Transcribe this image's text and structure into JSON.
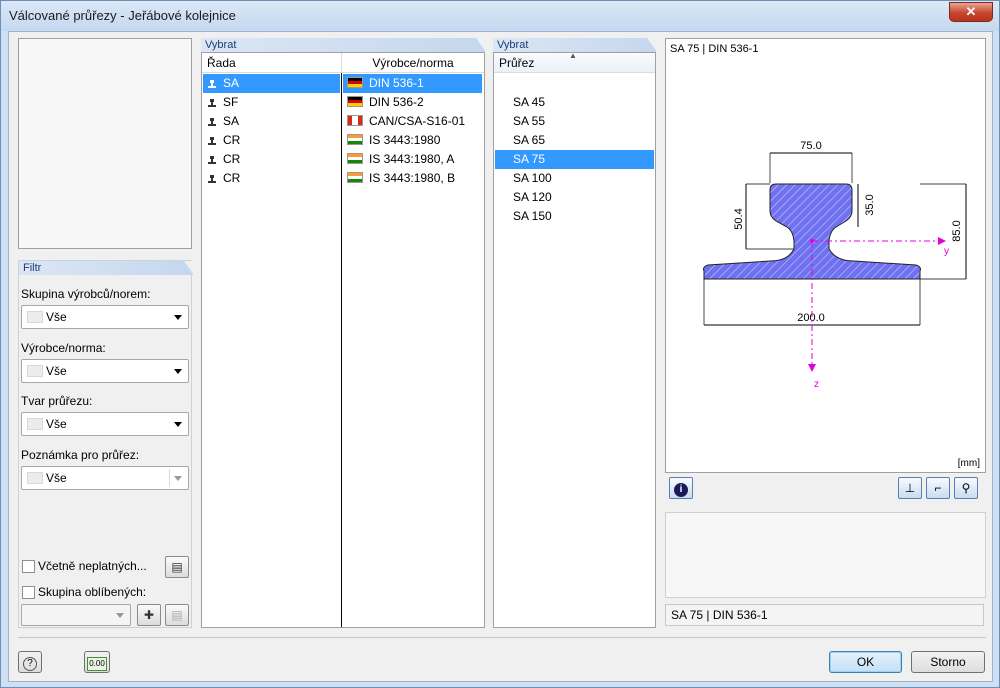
{
  "window": {
    "title": "Válcované průřezy - Jeřábové kolejnice",
    "close_label": "✕"
  },
  "filter": {
    "header": "Filtr",
    "group_label": "Skupina výrobců/norem:",
    "group_value": "Vše",
    "manufacturer_label": "Výrobce/norma:",
    "manufacturer_value": "Vše",
    "shape_label": "Tvar průřezu:",
    "shape_value": "Vše",
    "note_label": "Poznámka pro průřez:",
    "note_value": "Vše",
    "include_invalid_label": "Včetně neplatných...",
    "favorites_label": "Skupina oblíbených:"
  },
  "select_series": {
    "header": "Vybrat",
    "col_series": "Řada",
    "col_manufacturer": "Výrobce/norma",
    "rows": [
      {
        "series": "SA",
        "manufacturer": "DIN 536-1",
        "flag": "de",
        "selected": true
      },
      {
        "series": "SF",
        "manufacturer": "DIN 536-2",
        "flag": "de",
        "selected": false
      },
      {
        "series": "SA",
        "manufacturer": "CAN/CSA-S16-01",
        "flag": "ca",
        "selected": false
      },
      {
        "series": "CR",
        "manufacturer": "IS 3443:1980",
        "flag": "in",
        "selected": false
      },
      {
        "series": "CR",
        "manufacturer": "IS 3443:1980, A",
        "flag": "in",
        "selected": false
      },
      {
        "series": "CR",
        "manufacturer": "IS 3443:1980, B",
        "flag": "in",
        "selected": false
      }
    ]
  },
  "select_section": {
    "header": "Vybrat",
    "col_section": "Průřez",
    "rows": [
      "SA 45",
      "SA 55",
      "SA 65",
      "SA 75",
      "SA 100",
      "SA 120",
      "SA 150"
    ],
    "selected_index": 3
  },
  "preview": {
    "title": "SA 75 | DIN 536-1",
    "dim_top": "75.0",
    "dim_left": "50.4",
    "dim_head": "35.0",
    "dim_height": "85.0",
    "dim_base": "200.0",
    "axis_y": "y",
    "axis_z": "z",
    "units": "[mm]",
    "status": "SA 75 | DIN 536-1",
    "colors": {
      "section_fill": "#6f71f0",
      "axis": "#e000e0"
    }
  },
  "footer": {
    "ok_label": "OK",
    "cancel_label": "Storno",
    "calc_icon_text": "0.00"
  }
}
